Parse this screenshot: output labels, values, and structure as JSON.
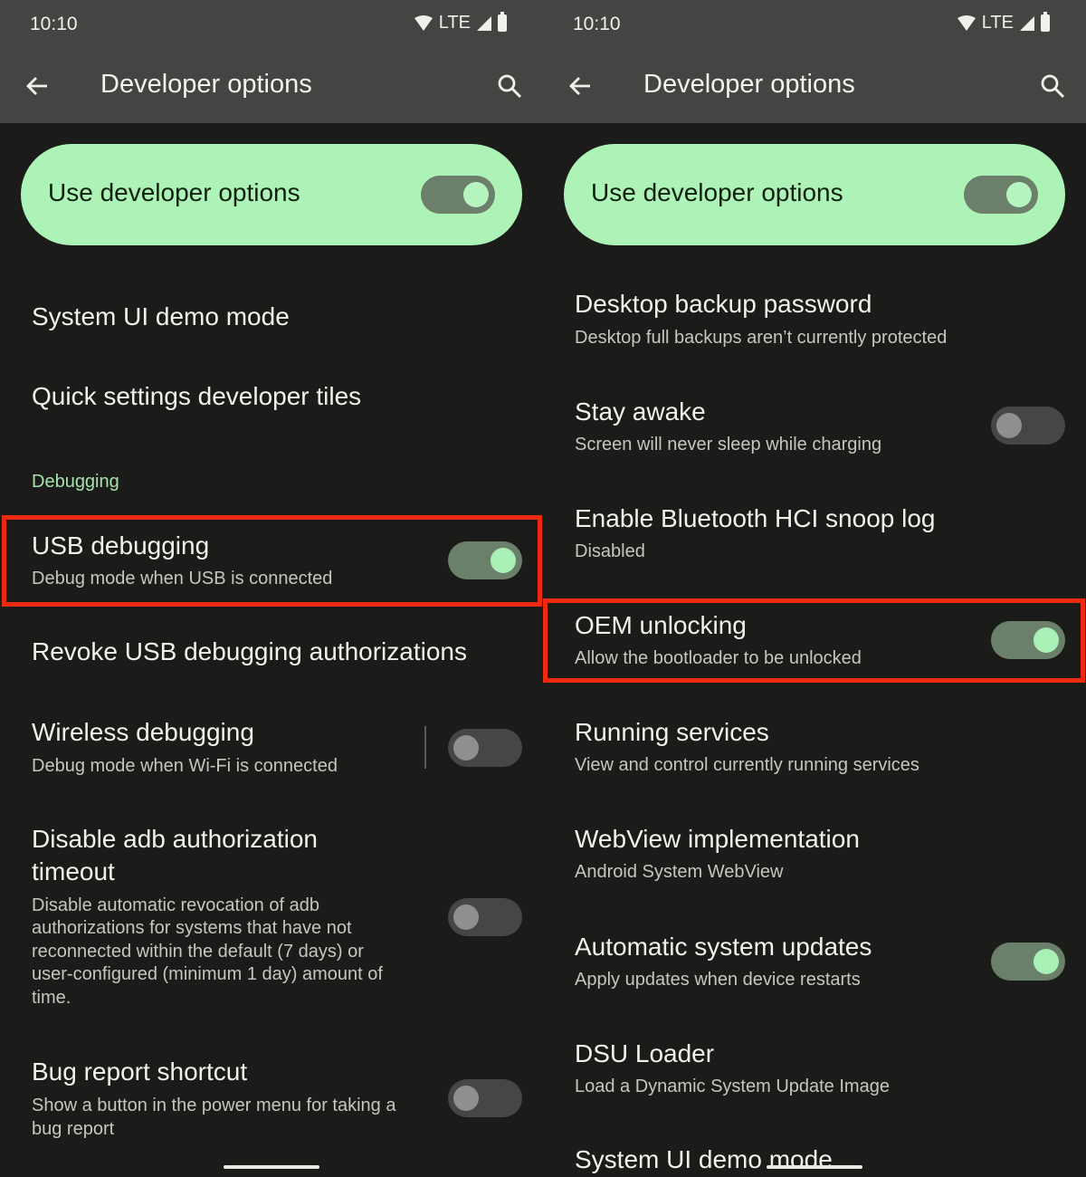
{
  "status_bar": {
    "time": "10:10",
    "network": "LTE",
    "icons": [
      "wifi-icon",
      "signal-icon",
      "battery-icon"
    ]
  },
  "app_bar": {
    "title": "Developer options",
    "back_icon": "arrow-left-icon",
    "search_icon": "search-icon"
  },
  "colors": {
    "top_bar": "#444543",
    "background": "#1b1c1a",
    "main_card": "#adf2b7",
    "switch_on_track": "#6b806b",
    "switch_on_thumb": "#a8f0b5",
    "switch_off_track": "#454745",
    "switch_off_thumb": "#8e908d",
    "section_header": "#a6e3ad",
    "highlight_box": "#ee2a0f"
  },
  "left_screen": {
    "main_toggle": {
      "label": "Use developer options",
      "on": true
    },
    "items": [
      {
        "title": "System UI demo mode"
      },
      {
        "title": "Quick settings developer tiles"
      }
    ],
    "section_header": "Debugging",
    "debug_items": [
      {
        "title": "USB debugging",
        "subtitle": "Debug mode when USB is connected",
        "toggle": true,
        "highlighted": true
      },
      {
        "title": "Revoke USB debugging authorizations"
      },
      {
        "title": "Wireless debugging",
        "subtitle": "Debug mode when Wi-Fi is connected",
        "toggle": false
      },
      {
        "title_line1": "Disable adb authorization",
        "title_line2": "timeout",
        "subtitle_lines": [
          "Disable automatic revocation of adb",
          "authorizations for systems that have not",
          "reconnected within the default (7 days) or",
          "user-configured (minimum 1 day) amount of",
          "time."
        ],
        "toggle": false
      },
      {
        "title": "Bug report shortcut",
        "subtitle_lines": [
          "Show a button in the power menu for taking a",
          "bug report"
        ],
        "toggle": false
      }
    ]
  },
  "right_screen": {
    "main_toggle": {
      "label": "Use developer options",
      "on": true
    },
    "items": [
      {
        "title": "Desktop backup password",
        "subtitle": "Desktop full backups aren’t currently protected"
      },
      {
        "title": "Stay awake",
        "subtitle": "Screen will never sleep while charging",
        "toggle": false
      },
      {
        "title": "Enable Bluetooth HCI snoop log",
        "subtitle": "Disabled"
      },
      {
        "title": "OEM unlocking",
        "subtitle": "Allow the bootloader to be unlocked",
        "toggle": true,
        "highlighted": true
      },
      {
        "title": "Running services",
        "subtitle": "View and control currently running services"
      },
      {
        "title": "WebView implementation",
        "subtitle": "Android System WebView"
      },
      {
        "title": "Automatic system updates",
        "subtitle": "Apply updates when device restarts",
        "toggle": true
      },
      {
        "title": "DSU Loader",
        "subtitle": "Load a Dynamic System Update Image"
      },
      {
        "title": "System UI demo mode"
      }
    ]
  }
}
